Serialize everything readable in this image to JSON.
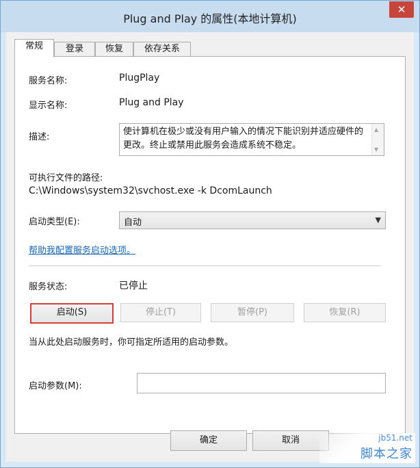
{
  "window": {
    "title": "Plug and Play 的属性(本地计算机)",
    "close": "✕"
  },
  "tabs": [
    "常规",
    "登录",
    "恢复",
    "依存关系"
  ],
  "general": {
    "service_name_label": "服务名称:",
    "service_name": "PlugPlay",
    "display_name_label": "显示名称:",
    "display_name": "Plug and Play",
    "description_label": "描述:",
    "description": "使计算机在极少或没有用户输入的情况下能识别并适应硬件的更改。终止或禁用此服务会造成系统不稳定。",
    "path_label": "可执行文件的路径:",
    "path": "C:\\Windows\\system32\\svchost.exe -k DcomLaunch",
    "startup_type_label": "启动类型(E):",
    "startup_type": "自动",
    "help_link": "帮助我配置服务启动选项。",
    "status_label": "服务状态:",
    "status": "已停止",
    "buttons": {
      "start": "启动(S)",
      "stop": "停止(T)",
      "pause": "暂停(P)",
      "resume": "恢复(R)"
    },
    "hint": "当从此处启动服务时，你可指定所适用的启动参数。",
    "params_label": "启动参数(M):",
    "params_value": ""
  },
  "footer": {
    "ok": "确定",
    "cancel": "取消"
  },
  "watermark": {
    "site": "jb51.net",
    "name": "脚本之家"
  },
  "colors": {
    "accent_highlight": "#d93a3a",
    "link": "#1466b5",
    "close_button": "#c7463b"
  }
}
